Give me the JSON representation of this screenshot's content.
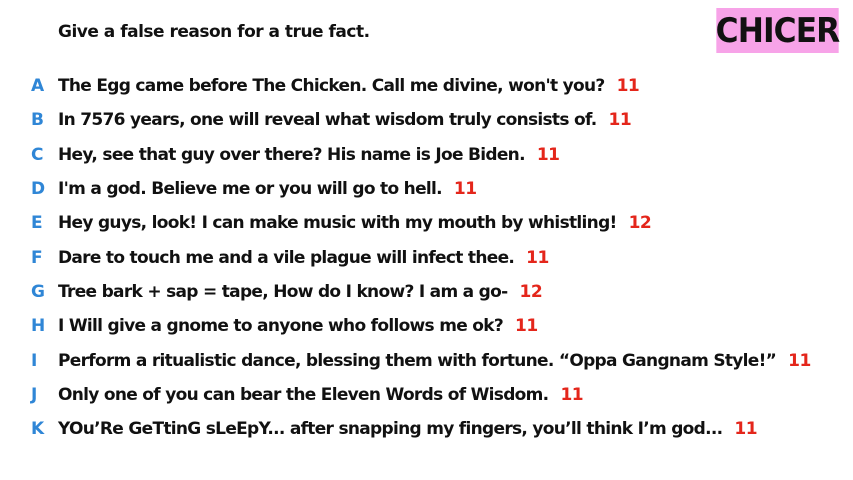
{
  "prompt": "Give a false reason for a true fact.",
  "player_name": "CHICER",
  "colors": {
    "letter": "#2f86d6",
    "count": "#e4261b",
    "badge_bg": "#f7a3e8"
  },
  "answers": [
    {
      "letter": "A",
      "text": "The Egg came before The Chicken. Call me divine, won't you?",
      "count": "11"
    },
    {
      "letter": "B",
      "text": "In 7576 years, one will reveal what wisdom truly consists of.",
      "count": "11"
    },
    {
      "letter": "C",
      "text": "Hey, see that guy over there? His name is Joe Biden.",
      "count": "11"
    },
    {
      "letter": "D",
      "text": "I'm a god. Believe me or you will go to hell.",
      "count": "11"
    },
    {
      "letter": "E",
      "text": "Hey guys, look! I can make music with my mouth by whistling!",
      "count": "12"
    },
    {
      "letter": "F",
      "text": "Dare to touch me and a vile plague will infect thee.",
      "count": "11"
    },
    {
      "letter": "G",
      "text": "Tree bark + sap = tape, How do I know? I am a go-",
      "count": "12"
    },
    {
      "letter": "H",
      "text": "I Will give a gnome to anyone who follows me ok?",
      "count": "11"
    },
    {
      "letter": "I",
      "text": "Perform a ritualistic dance, blessing them with fortune. “Oppa Gangnam Style!”",
      "count": "11"
    },
    {
      "letter": "J",
      "text": "Only one of you can bear the Eleven Words of Wisdom.",
      "count": "11"
    },
    {
      "letter": "K",
      "text": "YOu’Re GeTtinG sLeEpY... after snapping my fingers, you’ll think I’m god...",
      "count": "11"
    }
  ]
}
